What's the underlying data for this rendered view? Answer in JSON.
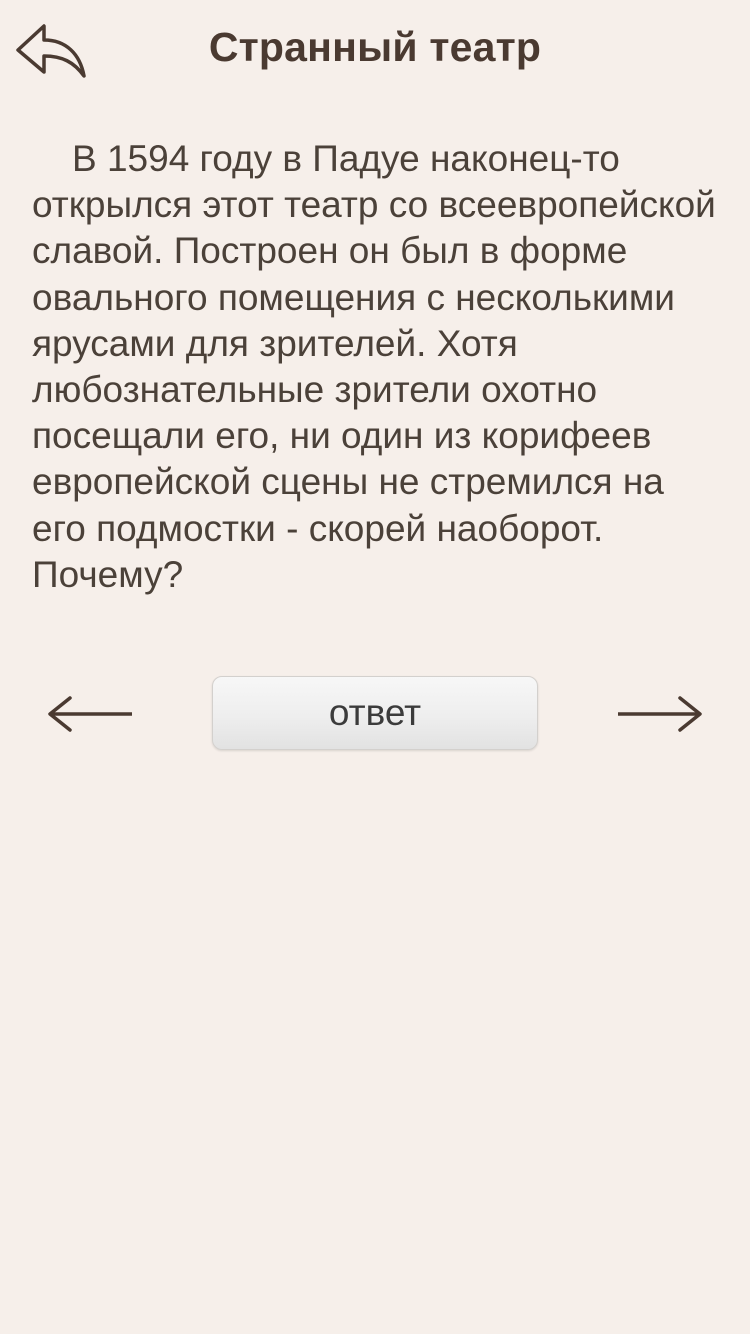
{
  "header": {
    "title": "Странный театр",
    "back_icon": "reply-arrow-icon"
  },
  "question": {
    "text": "В 1594 году в Падуе наконец-то открылся этот театр со всеевропейской славой. Построен он был в форме овального помещения с несколькими ярусами для зрителей. Хотя любознательные зрители охотно посещали его, ни один из корифеев европейской сцены не стремился на его подмостки - скорей наоборот. Почему?"
  },
  "controls": {
    "answer_label": "ответ",
    "prev_icon": "arrow-left-icon",
    "next_icon": "arrow-right-icon"
  },
  "colors": {
    "background": "#f6efea",
    "text": "#4a3a31",
    "button_bg": "#eeeeee"
  }
}
